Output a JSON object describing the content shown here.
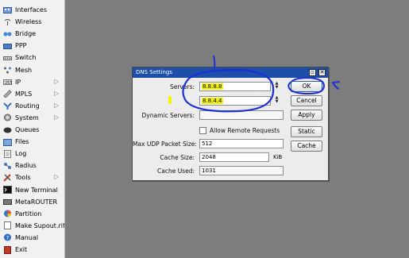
{
  "sidebar": {
    "items": [
      {
        "label": "Interfaces",
        "icon": "interfaces-icon",
        "has_submenu": false
      },
      {
        "label": "Wireless",
        "icon": "wireless-icon",
        "has_submenu": false
      },
      {
        "label": "Bridge",
        "icon": "bridge-icon",
        "has_submenu": false
      },
      {
        "label": "PPP",
        "icon": "ppp-icon",
        "has_submenu": false
      },
      {
        "label": "Switch",
        "icon": "switch-icon",
        "has_submenu": false
      },
      {
        "label": "Mesh",
        "icon": "mesh-icon",
        "has_submenu": false
      },
      {
        "label": "IP",
        "icon": "ip-icon",
        "has_submenu": true
      },
      {
        "label": "MPLS",
        "icon": "mpls-icon",
        "has_submenu": true
      },
      {
        "label": "Routing",
        "icon": "routing-icon",
        "has_submenu": true
      },
      {
        "label": "System",
        "icon": "system-icon",
        "has_submenu": true
      },
      {
        "label": "Queues",
        "icon": "queues-icon",
        "has_submenu": false
      },
      {
        "label": "Files",
        "icon": "files-icon",
        "has_submenu": false
      },
      {
        "label": "Log",
        "icon": "log-icon",
        "has_submenu": false
      },
      {
        "label": "Radius",
        "icon": "radius-icon",
        "has_submenu": false
      },
      {
        "label": "Tools",
        "icon": "tools-icon",
        "has_submenu": true
      },
      {
        "label": "New Terminal",
        "icon": "terminal-icon",
        "has_submenu": false
      },
      {
        "label": "MetaROUTER",
        "icon": "metarouter-icon",
        "has_submenu": false
      },
      {
        "label": "Partition",
        "icon": "partition-icon",
        "has_submenu": false
      },
      {
        "label": "Make Supout.rif",
        "icon": "supout-icon",
        "has_submenu": false
      },
      {
        "label": "Manual",
        "icon": "manual-icon",
        "has_submenu": false
      },
      {
        "label": "Exit",
        "icon": "exit-icon",
        "has_submenu": false
      }
    ],
    "submenu_arrow": "▷"
  },
  "dialog": {
    "title": "DNS Settings",
    "servers_label": "Servers:",
    "server_1": "8.8.8.8",
    "server_2": "8.8.4.4",
    "dynamic_servers_label": "Dynamic Servers:",
    "dynamic_servers_value": "",
    "allow_remote_label": "Allow Remote Requests",
    "allow_remote_checked": false,
    "max_udp_label": "Max UDP Packet Size:",
    "max_udp_value": "512",
    "cache_size_label": "Cache Size:",
    "cache_size_value": "2048",
    "cache_size_unit": "KiB",
    "cache_used_label": "Cache Used:",
    "cache_used_value": "1031",
    "buttons": {
      "ok": "OK",
      "cancel": "Cancel",
      "apply": "Apply",
      "static": "Static",
      "cache": "Cache"
    },
    "window_buttons": {
      "restore": "▫",
      "close": "✕"
    }
  },
  "colors": {
    "titlebar": "#1d4fa8",
    "annotation": "#1a2fd6",
    "highlight": "#f2f20f",
    "background": "#7d7d7d"
  }
}
